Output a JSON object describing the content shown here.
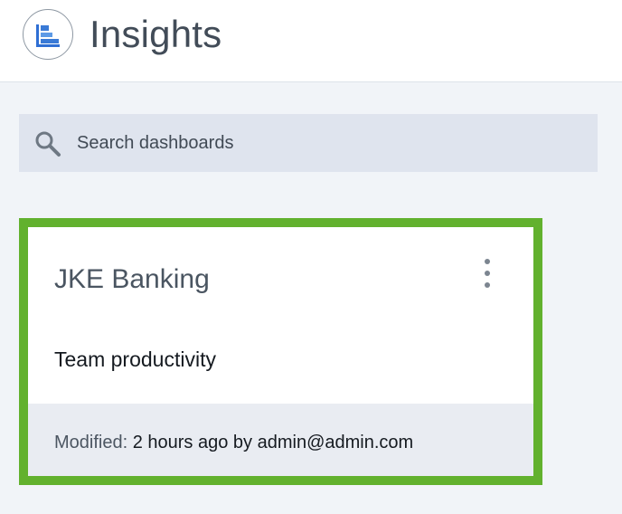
{
  "header": {
    "title": "Insights",
    "logo_icon": "bar-chart-icon",
    "logo_color": "#3a7ad6"
  },
  "search": {
    "placeholder": "Search dashboards",
    "value": "",
    "icon": "search-icon"
  },
  "dashboards": [
    {
      "title": "JKE Banking",
      "description": "Team productivity",
      "modified_label": "Modified:",
      "modified_value": "2 hours ago by admin@admin.com",
      "menu_icon": "kebab-menu-icon",
      "selected_border_color": "#62b12e"
    }
  ]
}
